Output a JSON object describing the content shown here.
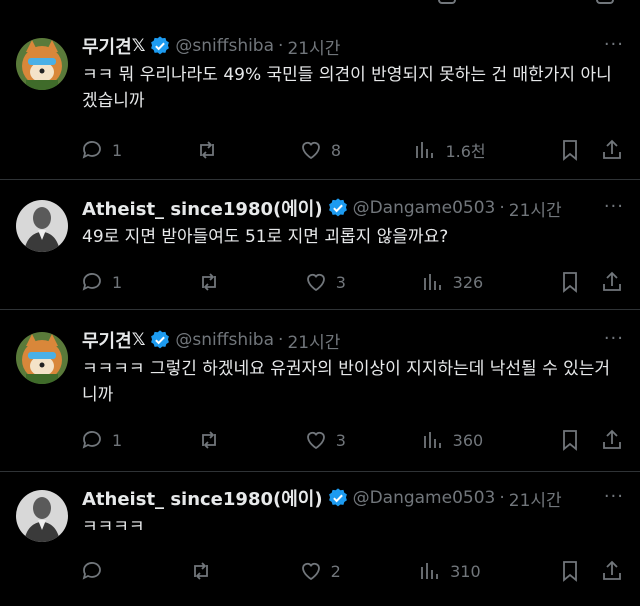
{
  "colors": {
    "background": "#000000",
    "text_primary": "#e7e9ea",
    "text_secondary": "#71767b",
    "verified_blue": "#1d9bf0",
    "divider": "#2f3336"
  },
  "tweets": [
    {
      "display_name": "무기견",
      "handle": "@sniffshiba",
      "time": "21시간",
      "text": "ㅋㅋ 뭐 우리나라도 49% 국민들 의견이 반영되지 못하는 건 매한가지 아니겠습니까",
      "replies": "1",
      "retweets": "",
      "likes": "8",
      "views": "1.6천",
      "avatar": "shiba-avatar"
    },
    {
      "display_name": "Atheist_ since1980(에이)",
      "handle": "@Dangame0503",
      "time": "21시간",
      "text": "49로 지면 받아들여도 51로 지면 괴롭지 않을까요?",
      "replies": "1",
      "retweets": "",
      "likes": "3",
      "views": "326",
      "avatar": "portrait-avatar"
    },
    {
      "display_name": "무기견",
      "handle": "@sniffshiba",
      "time": "21시간",
      "text": "ㅋㅋㅋㅋ 그렇긴 하겠네요 유권자의 반이상이 지지하는데 낙선될 수 있는거니까",
      "replies": "1",
      "retweets": "",
      "likes": "3",
      "views": "360",
      "avatar": "shiba-avatar"
    },
    {
      "display_name": "Atheist_ since1980(에이)",
      "handle": "@Dangame0503",
      "time": "21시간",
      "text": "ㅋㅋㅋㅋ",
      "replies": "",
      "retweets": "",
      "likes": "2",
      "views": "310",
      "avatar": "portrait-avatar"
    }
  ],
  "separator": "·",
  "more_glyph": "···",
  "x_mark": "𝕏"
}
